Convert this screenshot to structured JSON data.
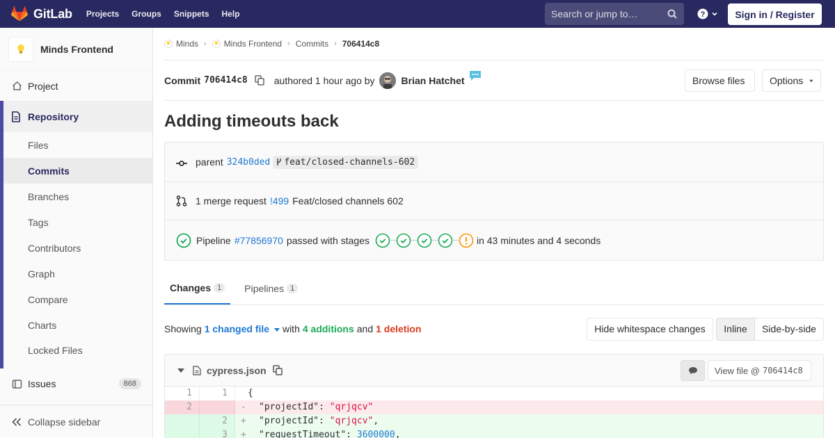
{
  "navbar": {
    "brand": "GitLab",
    "links": [
      "Projects",
      "Groups",
      "Snippets",
      "Help"
    ],
    "search_placeholder": "Search or jump to…",
    "signin_label": "Sign in / Register"
  },
  "sidebar": {
    "project_name": "Minds Frontend",
    "project_item": "Project",
    "repository_label": "Repository",
    "repo_items": [
      "Files",
      "Commits",
      "Branches",
      "Tags",
      "Contributors",
      "Graph",
      "Compare",
      "Charts",
      "Locked Files"
    ],
    "issues_label": "Issues",
    "issues_count": "868",
    "collapse_label": "Collapse sidebar"
  },
  "breadcrumbs": [
    "Minds",
    "Minds Frontend",
    "Commits",
    "706414c8"
  ],
  "commit": {
    "label": "Commit",
    "sha": "706414c8",
    "authored": "authored 1 hour ago by",
    "author": "Brian Hatchet",
    "browse_files": "Browse files",
    "options": "Options",
    "title": "Adding timeouts back"
  },
  "info": {
    "parent_label": "parent",
    "parent_sha": "324b0ded",
    "branch": "feat/closed-channels-602",
    "mr_text": "1 merge request",
    "mr_ref": "!499",
    "mr_title": "Feat/closed channels 602",
    "pipeline_label": "Pipeline",
    "pipeline_ref": "#77856970",
    "pipeline_status": "passed with stages",
    "pipeline_duration": "in 43 minutes and 4 seconds",
    "stages": [
      "passed",
      "passed",
      "passed",
      "passed",
      "warning"
    ]
  },
  "tabs": [
    {
      "label": "Changes",
      "count": "1"
    },
    {
      "label": "Pipelines",
      "count": "1"
    }
  ],
  "summary": {
    "showing": "Showing",
    "changed": "1 changed file",
    "with": "with",
    "additions": "4 additions",
    "and": "and",
    "deletions": "1 deletion",
    "hide_ws": "Hide whitespace changes",
    "inline": "Inline",
    "side_by_side": "Side-by-side"
  },
  "file": {
    "name": "cypress.json",
    "view_file": "View file @",
    "view_sha": "706414c8"
  },
  "diff_lines": [
    {
      "old": "1",
      "new": "1",
      "type": "ctx",
      "sign": "",
      "code": "{"
    },
    {
      "old": "2",
      "new": "",
      "type": "del",
      "sign": "-",
      "key": "\"projectId\"",
      "sep": ": ",
      "val": "\"qrjqcv\"",
      "tail": ""
    },
    {
      "old": "",
      "new": "2",
      "type": "add",
      "sign": "+",
      "key": "\"projectId\"",
      "sep": ": ",
      "val": "\"qrjqcv\"",
      "tail": ","
    },
    {
      "old": "",
      "new": "3",
      "type": "add",
      "sign": "+",
      "key": "\"requestTimeout\"",
      "sep": ": ",
      "num": "3600000",
      "tail": ","
    }
  ]
}
